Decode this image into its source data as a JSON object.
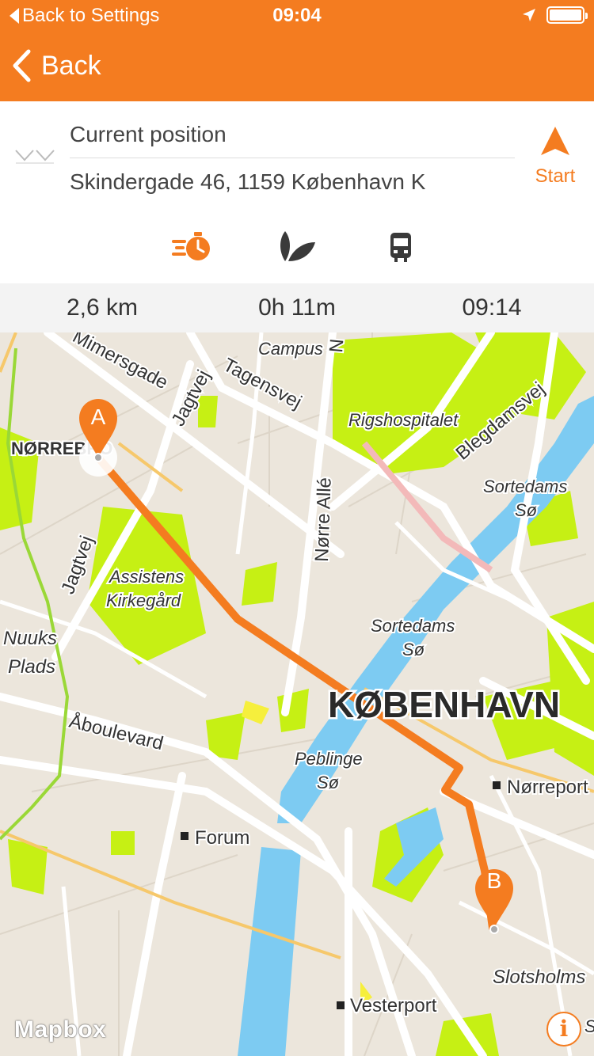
{
  "status_bar": {
    "back_app": "Back to Settings",
    "time": "09:04",
    "location_icon": "location-arrow-icon",
    "battery_icon": "battery-full-icon"
  },
  "nav": {
    "back_label": "Back",
    "back_icon": "chevron-left-icon"
  },
  "route": {
    "from": "Current position",
    "to": "Skindergade 46, 1159 København K",
    "start_label": "Start",
    "start_icon": "navigation-arrow-icon",
    "swap_icon": "swap-chevrons-icon",
    "modes": [
      {
        "name": "fast",
        "icon": "stopwatch-icon",
        "active": true
      },
      {
        "name": "green",
        "icon": "leaf-icon",
        "active": false
      },
      {
        "name": "transit",
        "icon": "train-icon",
        "active": false
      }
    ]
  },
  "summary": {
    "distance": "2,6 km",
    "duration": "0h 11m",
    "arrival": "09:14"
  },
  "map": {
    "labels": {
      "mimersgade": "Mimersgade",
      "campus": "Campus",
      "tagensvej": "Tagensvej",
      "jagtvej_top": "Jagtvej",
      "rigshospitalet": "Rigshospitalet",
      "blegdamsvej": "Blegdamsvej",
      "norrebro": "NØRREBRO",
      "sortedams_so_1a": "Sortedams",
      "sortedams_so_1b": "Sø",
      "norre_alle": "Nørre Allé",
      "jagtvej_bottom": "Jagtvej",
      "assistens_a": "Assistens",
      "assistens_b": "Kirkegård",
      "sortedams_so_2a": "Sortedams",
      "sortedams_so_2b": "Sø",
      "nuuks_a": "Nuuks",
      "nuuks_b": "Plads",
      "kobenhavn": "KØBENHAVN",
      "aboulevard": "Åboulevard",
      "peblinge_a": "Peblinge",
      "peblinge_b": "Sø",
      "norreport": "Nørreport",
      "forum": "Forum",
      "slotsholmsg": "Slotsholms",
      "vesterport": "Vesterport",
      "edge_s": "S",
      "edge_n": "N"
    },
    "marker_a": "A",
    "marker_b": "B",
    "route_color": "#f47c20",
    "water_color": "#7dcbf2",
    "park_color": "#c6f014",
    "attribution": "Mapbox",
    "info_label": "i"
  },
  "colors": {
    "accent": "#f47c20",
    "inactive_icon": "#3a3a3a"
  }
}
